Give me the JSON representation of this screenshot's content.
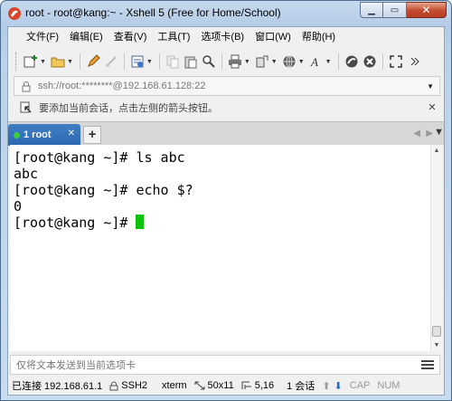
{
  "window": {
    "title": "root - root@kang:~ - Xshell 5 (Free for Home/School)",
    "minimize_glyph": "▁",
    "maximize_glyph": "▭",
    "close_glyph": "✕"
  },
  "menu": {
    "items": [
      "文件(F)",
      "编辑(E)",
      "查看(V)",
      "工具(T)",
      "选项卡(B)",
      "窗口(W)",
      "帮助(H)"
    ]
  },
  "toolbar": {
    "icons": [
      "new-session-icon",
      "open-folder-icon",
      "edit-icon",
      "disconnect-icon",
      "properties-icon",
      "copy-icon",
      "paste-icon",
      "find-icon",
      "print-icon",
      "transfer-icon",
      "globe-icon",
      "font-icon",
      "xftp-icon",
      "xshell-icon",
      "fullscreen-icon",
      "more-icon"
    ]
  },
  "address": {
    "value": "ssh://root:********@192.168.61.128:22"
  },
  "hint": {
    "text": "要添加当前会话，点击左侧的箭头按钮。",
    "close_glyph": "✕"
  },
  "tabs": {
    "active_label": "1 root",
    "add_label": "+",
    "close_glyph": "✕",
    "nav_left": "◀",
    "nav_right": "▶",
    "nav_menu": "▼"
  },
  "terminal": {
    "lines": [
      "[root@kang ~]# ls abc",
      "abc",
      "[root@kang ~]# echo $?",
      "0",
      "[root@kang ~]# "
    ],
    "cursor_color": "#0ac30a"
  },
  "sendbar": {
    "placeholder": "仅将文本发送到当前选项卡"
  },
  "status": {
    "connection": "已连接 192.168.61.1",
    "protocol": "SSH2",
    "terminal_type": "xterm",
    "size": "50x11",
    "position": "5,16",
    "sessions": "1 会话",
    "caps": "CAP",
    "num": "NUM"
  },
  "colors": {
    "tab_active": "#2b66ad",
    "cursor": "#0ac30a",
    "close_button": "#c54a2f"
  }
}
